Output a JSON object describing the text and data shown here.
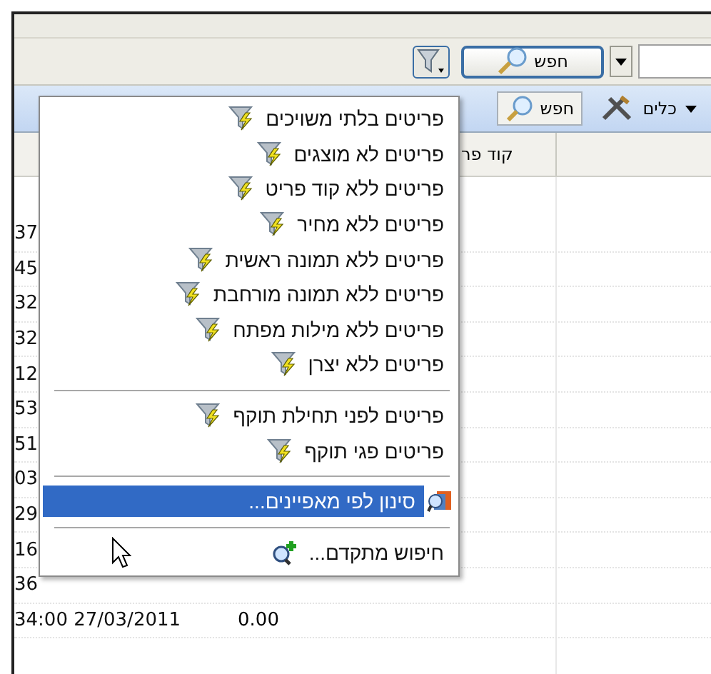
{
  "toolbar": {
    "search_button": "חפש"
  },
  "toolbar_2": {
    "search_button": "חפש",
    "tools_button": "כלים"
  },
  "grid": {
    "column_header": "קוד פר",
    "row_fragments": [
      "37",
      "45",
      "32",
      "32",
      "12",
      "53",
      "51",
      "03",
      "29",
      "16",
      "36"
    ],
    "last_row": {
      "date": "34:00 27/03/2011",
      "amount": "0.00"
    }
  },
  "menu": {
    "groups": [
      {
        "items": [
          {
            "kind": "filter",
            "label": "פריטים בלתי משויכים",
            "selected": false
          },
          {
            "kind": "filter",
            "label": "פריטים לא מוצגים",
            "selected": false
          },
          {
            "kind": "filter",
            "label": "פריטים ללא קוד פריט",
            "selected": false
          },
          {
            "kind": "filter",
            "label": "פריטים ללא מחיר",
            "selected": false
          },
          {
            "kind": "filter",
            "label": "פריטים ללא תמונה ראשית",
            "selected": false
          },
          {
            "kind": "filter",
            "label": "פריטים ללא תמונה מורחבת",
            "selected": false
          },
          {
            "kind": "filter",
            "label": "פריטים ללא מילות מפתח",
            "selected": false
          },
          {
            "kind": "filter",
            "label": "פריטים ללא יצרן",
            "selected": false
          }
        ]
      },
      {
        "items": [
          {
            "kind": "filter",
            "label": "פריטים לפני תחילת תוקף",
            "selected": false
          },
          {
            "kind": "filter",
            "label": "פריטים פגי תוקף",
            "selected": false
          }
        ]
      },
      {
        "items": [
          {
            "kind": "properties",
            "label": "סינון לפי מאפיינים...",
            "selected": true
          }
        ]
      },
      {
        "items": [
          {
            "kind": "advanced",
            "label": "חיפוש מתקדם...",
            "selected": false
          }
        ]
      }
    ]
  }
}
